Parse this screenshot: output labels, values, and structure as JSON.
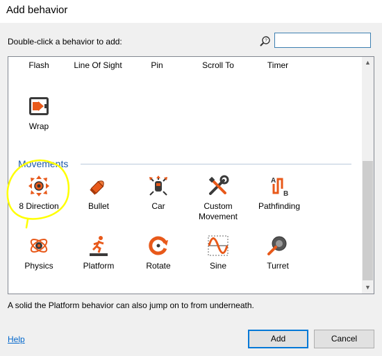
{
  "dialog": {
    "title": "Add behavior",
    "prompt": "Double-click a behavior to add:",
    "search": {
      "value": "",
      "placeholder": ""
    },
    "description": "A solid the Platform behavior can also jump on to from underneath.",
    "help_label": "Help",
    "add_label": "Add",
    "cancel_label": "Cancel"
  },
  "list": {
    "top_row": [
      "Flash",
      "Line Of Sight",
      "Pin",
      "Scroll To",
      "Timer"
    ],
    "wrap_label": "Wrap",
    "category": "Movements",
    "movements": [
      {
        "label": "8 Direction",
        "icon": "eight-direction-icon"
      },
      {
        "label": "Bullet",
        "icon": "bullet-icon"
      },
      {
        "label": "Car",
        "icon": "car-icon"
      },
      {
        "label": "Custom\nMovement",
        "icon": "custom-movement-icon"
      },
      {
        "label": "Pathfinding",
        "icon": "pathfinding-icon"
      },
      {
        "label": "Physics",
        "icon": "physics-icon"
      },
      {
        "label": "Platform",
        "icon": "platform-icon"
      },
      {
        "label": "Rotate",
        "icon": "rotate-icon"
      },
      {
        "label": "Sine",
        "icon": "sine-icon"
      },
      {
        "label": "Turret",
        "icon": "turret-icon"
      }
    ]
  },
  "colors": {
    "accent": "#0078d7",
    "category": "#1e5aa8",
    "icon_orange": "#e8591a",
    "highlight_annotation": "#ffff00"
  }
}
